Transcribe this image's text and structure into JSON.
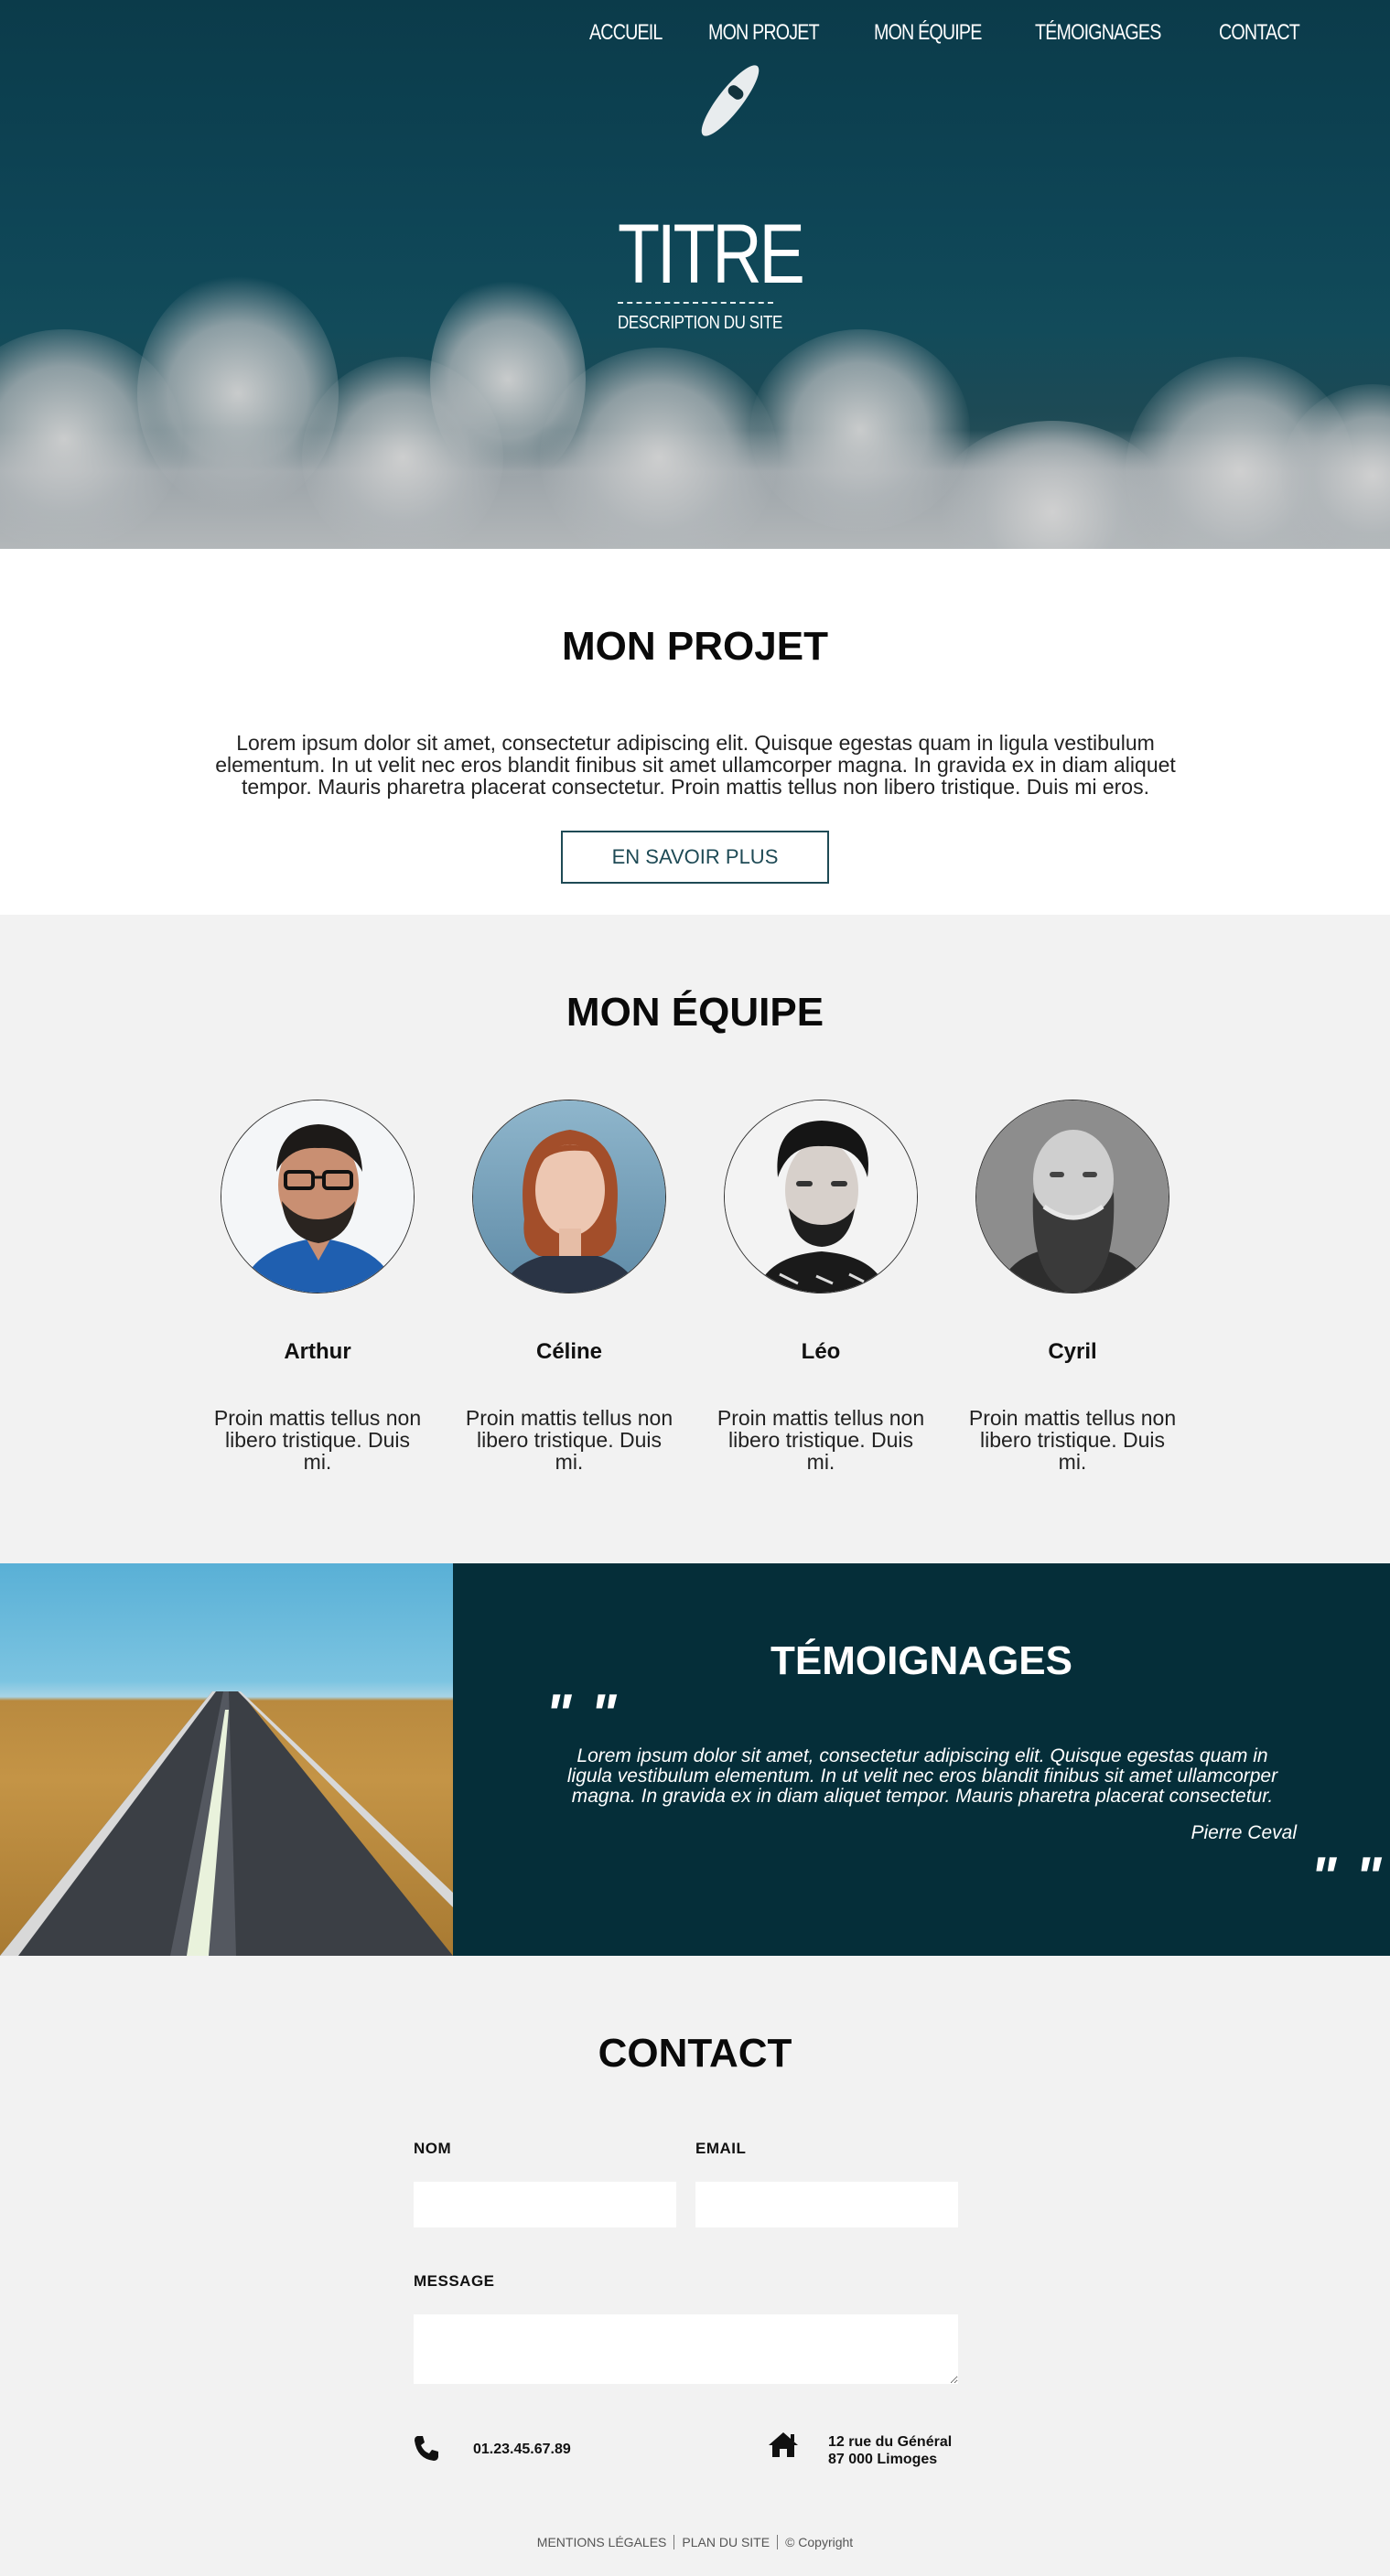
{
  "nav": {
    "items": [
      "ACCUEIL",
      "MON PROJET",
      "MON ÉQUIPE",
      "TÉMOIGNAGES",
      "CONTACT"
    ]
  },
  "hero": {
    "title": "TITRE",
    "description": "DESCRIPTION DU SITE"
  },
  "projet": {
    "title": "MON PROJET",
    "text": "Lorem ipsum dolor sit amet, consectetur adipiscing elit. Quisque egestas quam in ligula vestibulum elementum. In ut velit nec eros blandit finibus sit amet ullamcorper magna. In gravida ex in diam aliquet tempor. Mauris pharetra placerat consectetur. Proin mattis tellus non libero tristique. Duis mi eros.",
    "button": "EN SAVOIR PLUS"
  },
  "equipe": {
    "title": "MON ÉQUIPE",
    "members": [
      {
        "name": "Arthur",
        "desc": "Proin mattis tellus non libero tristique. Duis mi."
      },
      {
        "name": "Céline",
        "desc": "Proin mattis tellus non libero tristique. Duis mi."
      },
      {
        "name": "Léo",
        "desc": "Proin mattis tellus non libero tristique. Duis mi."
      },
      {
        "name": "Cyril",
        "desc": "Proin mattis tellus non libero tristique. Duis mi."
      }
    ]
  },
  "temoignages": {
    "title": "TÉMOIGNAGES",
    "quote_open": "\" \"",
    "quote_close": "\" \"",
    "text": "Lorem ipsum dolor sit amet, consectetur adipiscing elit. Quisque egestas quam in ligula vestibulum elementum. In ut velit nec eros blandit finibus sit amet ullamcorper magna. In gravida ex in diam aliquet tempor. Mauris pharetra placerat consectetur.",
    "author": "Pierre Ceval"
  },
  "contact": {
    "title": "CONTACT",
    "nom_label": "NOM",
    "email_label": "EMAIL",
    "message_label": "MESSAGE",
    "nom_value": "",
    "email_value": "",
    "message_value": "",
    "phone": "01.23.45.67.89",
    "address_line1": "12 rue du Général",
    "address_line2": "87 000 Limoges",
    "phone_icon": "phone-icon",
    "home_icon": "home-icon"
  },
  "footer": {
    "mentions": "MENTIONS LÉGALES",
    "plan": "PLAN DU SITE",
    "copyright": "© Copyright"
  },
  "colors": {
    "dark_teal": "#052e39",
    "button_border": "#1e4a55",
    "light_bg": "#f2f2f2"
  }
}
